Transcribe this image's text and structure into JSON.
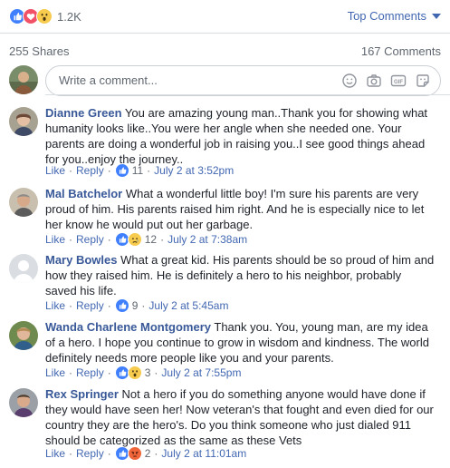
{
  "reactions": {
    "count": "1.2K",
    "icons": [
      "like-icon",
      "love-icon",
      "wow-icon"
    ]
  },
  "sort": {
    "label": "Top Comments"
  },
  "stats": {
    "shares": "255 Shares",
    "comments": "167 Comments"
  },
  "composer": {
    "placeholder": "Write a comment..."
  },
  "meta_labels": {
    "like": "Like",
    "reply": "Reply",
    "dot": "·"
  },
  "comments": [
    {
      "author": "Dianne Green",
      "text": "You are amazing young man..Thank you for showing what humanity looks like..You were her angle when she needed one. Your parents are doing a wonderful job in raising you..I see good things ahead for you..enjoy the journey..",
      "reactions": "11",
      "date": "July 2 at 3:52pm"
    },
    {
      "author": "Mal Batchelor",
      "text": "What a wonderful little boy! I'm sure his parents are very proud of him. His parents raised him right. And he is especially nice to let her know he would put out her garbage.",
      "reactions": "12",
      "date": "July 2 at 7:38am"
    },
    {
      "author": "Mary Bowles",
      "text": "What a great kid. His parents should be so proud of him and how they raised him. He is definitely a hero to his neighbor, probably saved his life.",
      "reactions": "9",
      "date": "July 2 at 5:45am"
    },
    {
      "author": "Wanda Charlene Montgomery",
      "text": "Thank you. You, young man, are my idea of a hero. I hope you continue to grow in wisdom and kindness. The world definitely needs more people like you and your parents.",
      "reactions": "3",
      "date": "July 2 at 7:55pm"
    },
    {
      "author": "Rex Springer",
      "text": "Not a hero if you do something anyone would have done if they would have seen her! Now veteran's that fought and even died for our country they are the hero's. Do you think someone who just dialed 911 should be categorized as the same as these Vets",
      "reactions": "2",
      "date": "July 2 at 11:01am"
    }
  ]
}
